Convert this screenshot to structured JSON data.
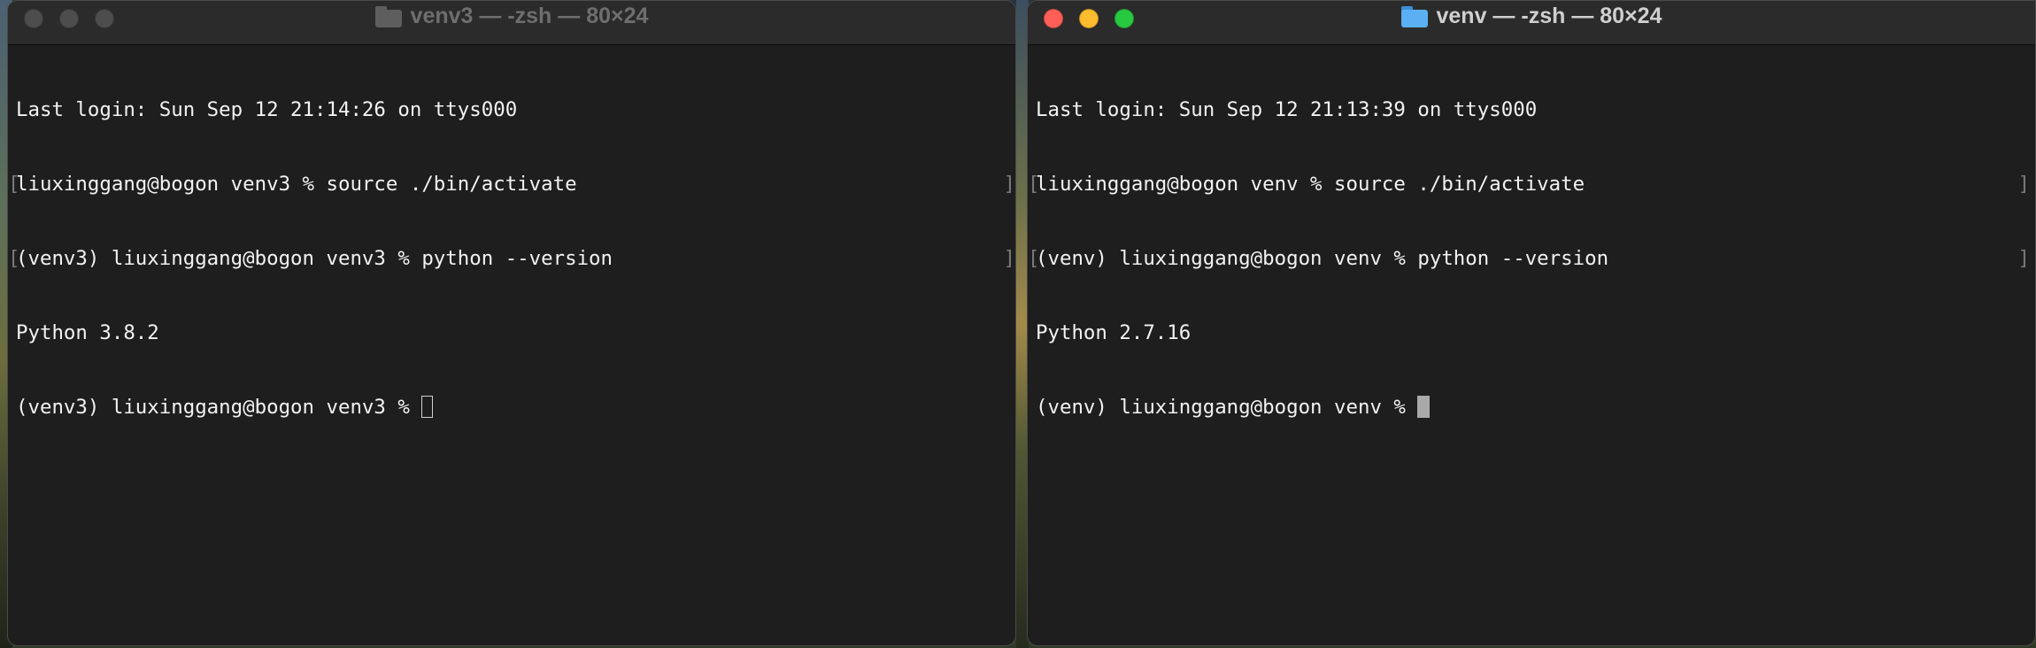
{
  "left_window": {
    "title": "venv3 — -zsh — 80×24",
    "icon": "folder-icon",
    "lines": {
      "l0": "Last login: Sun Sep 12 21:14:26 on ttys000",
      "l1": "liuxinggang@bogon venv3 % source ./bin/activate",
      "l2": "(venv3) liuxinggang@bogon venv3 % python --version",
      "l3": "Python 3.8.2",
      "l4": "(venv3) liuxinggang@bogon venv3 % "
    }
  },
  "right_window": {
    "title": "venv — -zsh — 80×24",
    "icon": "folder-icon",
    "lines": {
      "l0": "Last login: Sun Sep 12 21:13:39 on ttys000",
      "l1": "liuxinggang@bogon venv % source ./bin/activate",
      "l2": "(venv) liuxinggang@bogon venv % python --version",
      "l3": "Python 2.7.16",
      "l4": "(venv) liuxinggang@bogon venv % "
    }
  },
  "colors": {
    "close": "#ff5f57",
    "minimize": "#febc2e",
    "zoom": "#28c840",
    "terminal_bg": "#1e1e1e",
    "terminal_fg": "#f2f2f2"
  }
}
